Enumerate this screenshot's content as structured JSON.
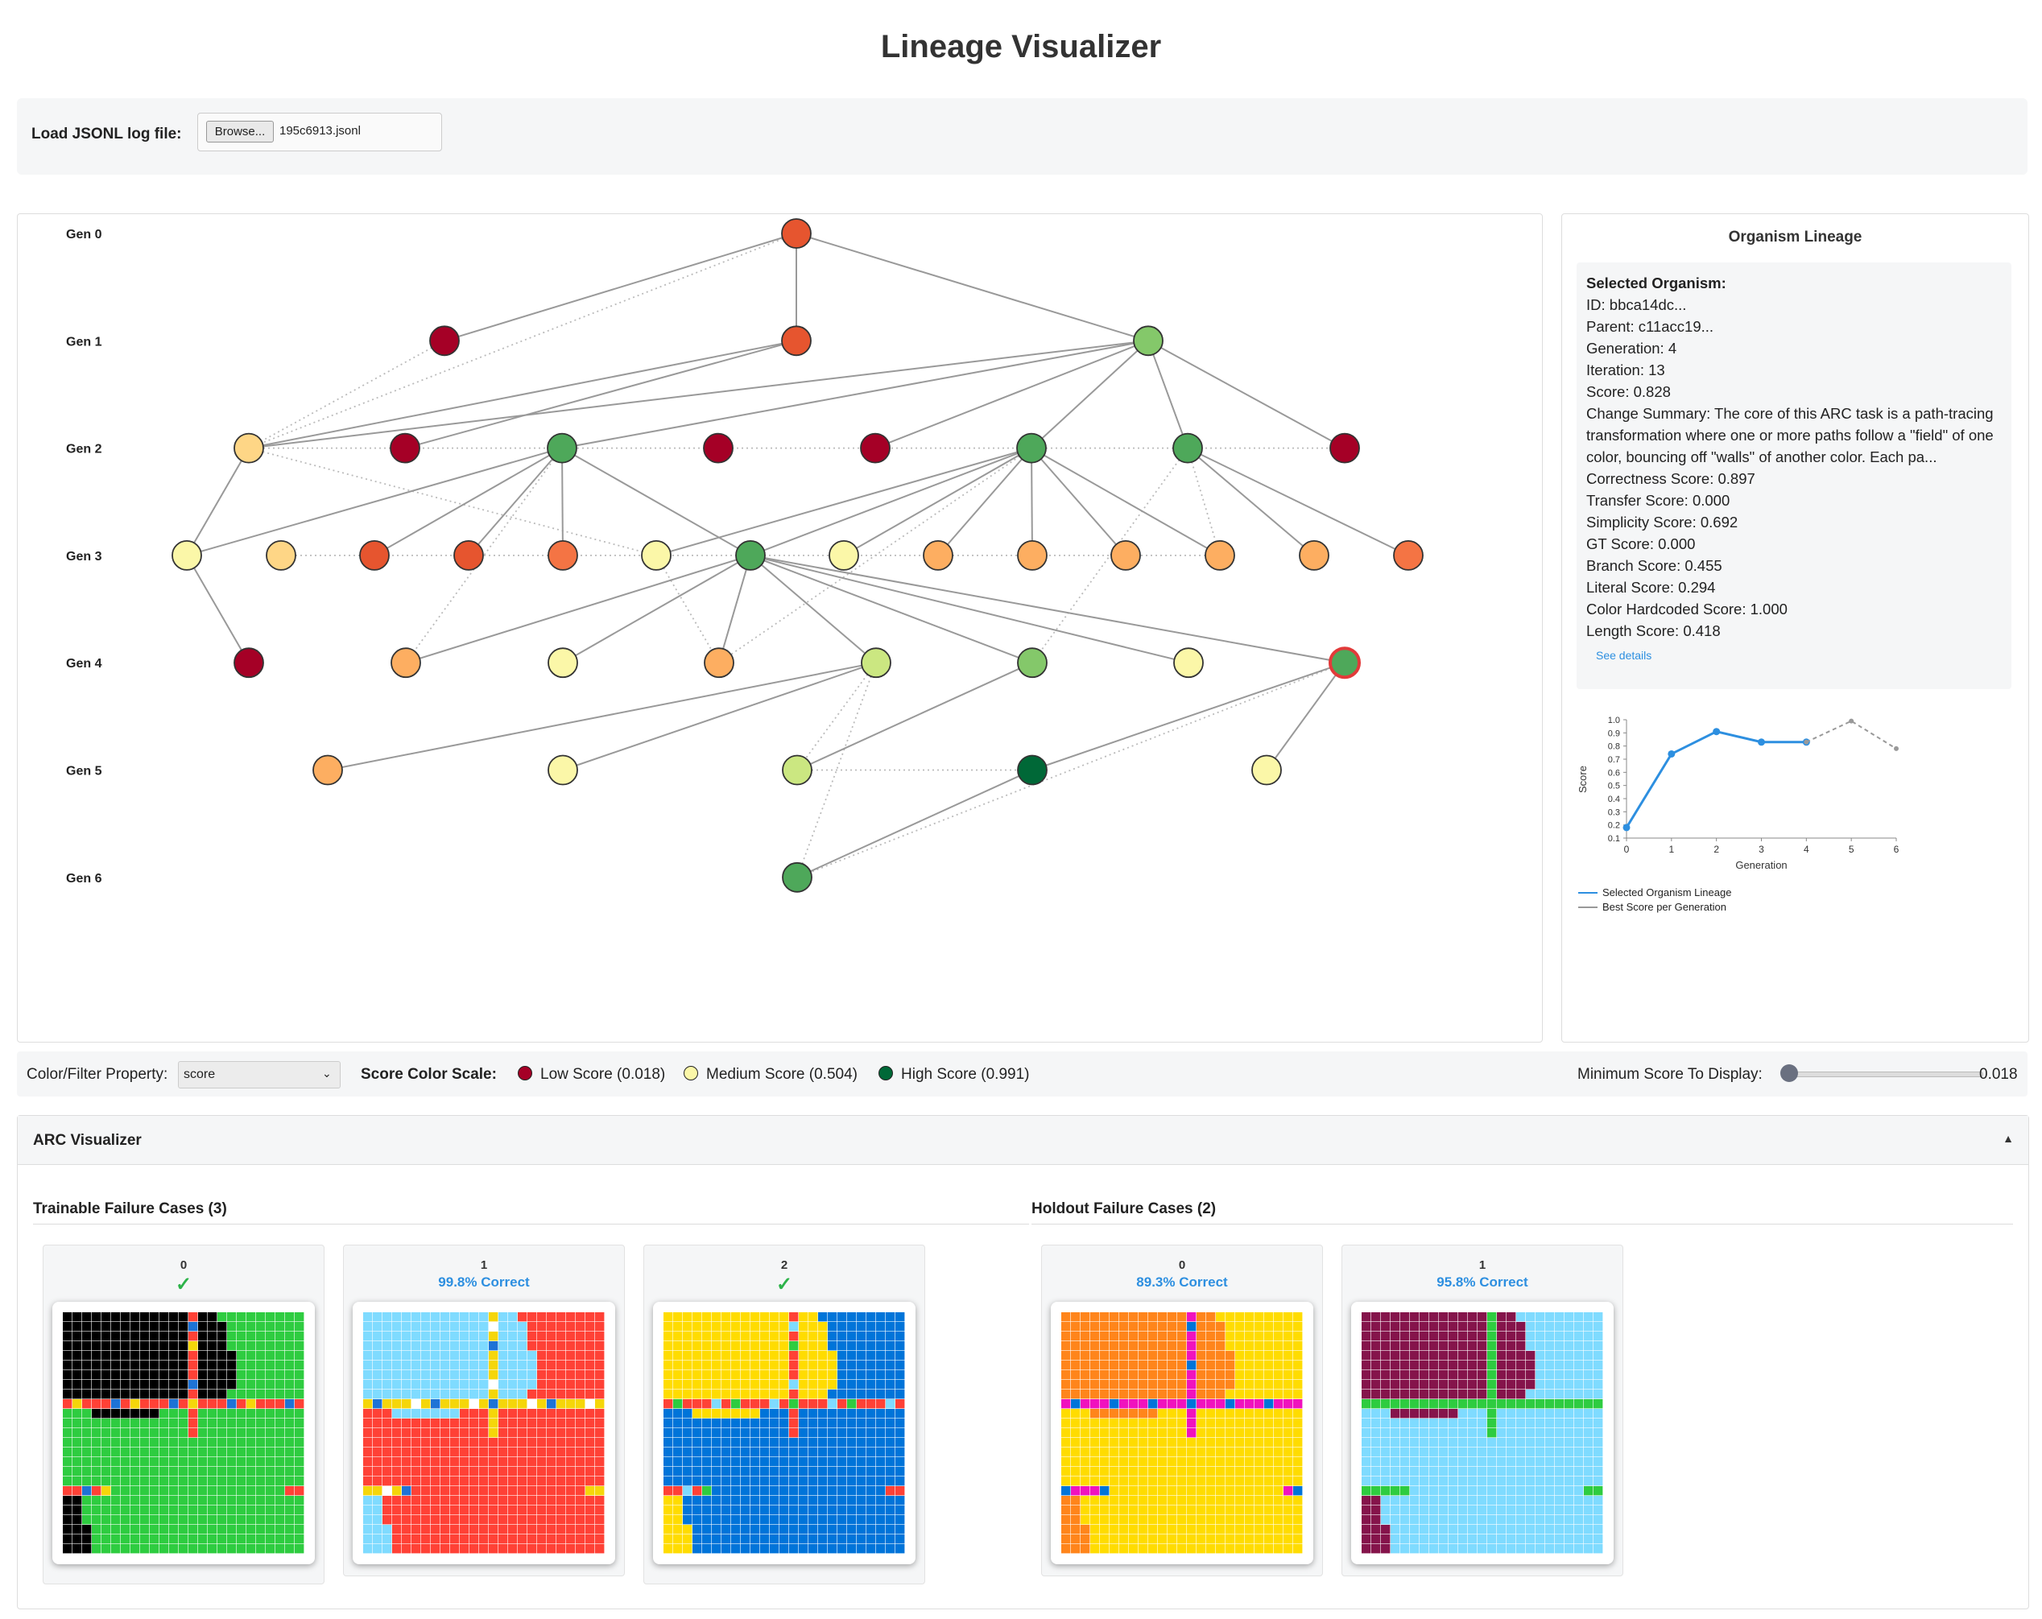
{
  "page": {
    "title": "Lineage Visualizer"
  },
  "loader": {
    "label": "Load JSONL log file:",
    "button": "Browse...",
    "filename": "195c6913.jsonl"
  },
  "graph": {
    "generations": [
      "Gen 0",
      "Gen 1",
      "Gen 2",
      "Gen 3",
      "Gen 4",
      "Gen 5",
      "Gen 6"
    ],
    "colors": {
      "dark_red": "#a50026",
      "red": "#e6552f",
      "orange": "#f47444",
      "light_orange": "#fdae61",
      "pale_orange": "#fed686",
      "pale_yellow": "#fbf7a8",
      "light_green": "#cbe781",
      "green": "#84c86a",
      "mid_green": "#4ea85a",
      "dark_green": "#006837"
    },
    "nodes": [
      {
        "id": "a",
        "gen": 0,
        "col": 967,
        "color": "red"
      },
      {
        "id": "b",
        "gen": 1,
        "col": 530,
        "color": "dark_red"
      },
      {
        "id": "c",
        "gen": 1,
        "col": 967,
        "color": "red"
      },
      {
        "id": "d",
        "gen": 1,
        "col": 1404,
        "color": "green"
      },
      {
        "id": "e",
        "gen": 2,
        "col": 287,
        "color": "pale_orange"
      },
      {
        "id": "f",
        "gen": 2,
        "col": 481,
        "color": "dark_red"
      },
      {
        "id": "g",
        "gen": 2,
        "col": 676,
        "color": "mid_green"
      },
      {
        "id": "h",
        "gen": 2,
        "col": 870,
        "color": "dark_red"
      },
      {
        "id": "i",
        "gen": 2,
        "col": 1065,
        "color": "dark_red"
      },
      {
        "id": "j",
        "gen": 2,
        "col": 1259,
        "color": "mid_green"
      },
      {
        "id": "k",
        "gen": 2,
        "col": 1453,
        "color": "mid_green"
      },
      {
        "id": "l",
        "gen": 2,
        "col": 1648,
        "color": "dark_red"
      },
      {
        "id": "m",
        "gen": 3,
        "col": 210,
        "color": "pale_yellow"
      },
      {
        "id": "n",
        "gen": 3,
        "col": 327,
        "color": "pale_orange"
      },
      {
        "id": "o",
        "gen": 3,
        "col": 443,
        "color": "red"
      },
      {
        "id": "p",
        "gen": 3,
        "col": 560,
        "color": "red"
      },
      {
        "id": "q",
        "gen": 3,
        "col": 677,
        "color": "orange"
      },
      {
        "id": "r",
        "gen": 3,
        "col": 793,
        "color": "pale_yellow"
      },
      {
        "id": "s",
        "gen": 3,
        "col": 910,
        "color": "mid_green"
      },
      {
        "id": "t",
        "gen": 3,
        "col": 1026,
        "color": "pale_yellow"
      },
      {
        "id": "u",
        "gen": 3,
        "col": 1143,
        "color": "light_orange"
      },
      {
        "id": "v",
        "gen": 3,
        "col": 1260,
        "color": "light_orange"
      },
      {
        "id": "w",
        "gen": 3,
        "col": 1376,
        "color": "light_orange"
      },
      {
        "id": "x",
        "gen": 3,
        "col": 1493,
        "color": "light_orange"
      },
      {
        "id": "y",
        "gen": 3,
        "col": 1610,
        "color": "light_orange"
      },
      {
        "id": "z",
        "gen": 3,
        "col": 1727,
        "color": "orange"
      },
      {
        "id": "A",
        "gen": 4,
        "col": 287,
        "color": "dark_red"
      },
      {
        "id": "B",
        "gen": 4,
        "col": 482,
        "color": "light_orange"
      },
      {
        "id": "C",
        "gen": 4,
        "col": 677,
        "color": "pale_yellow"
      },
      {
        "id": "D",
        "gen": 4,
        "col": 871,
        "color": "light_orange"
      },
      {
        "id": "E",
        "gen": 4,
        "col": 1066,
        "color": "light_green"
      },
      {
        "id": "F",
        "gen": 4,
        "col": 1260,
        "color": "green"
      },
      {
        "id": "G",
        "gen": 4,
        "col": 1454,
        "color": "pale_yellow"
      },
      {
        "id": "H",
        "gen": 4,
        "col": 1648,
        "color": "mid_green",
        "selected": true
      },
      {
        "id": "I",
        "gen": 5,
        "col": 385,
        "color": "light_orange"
      },
      {
        "id": "J",
        "gen": 5,
        "col": 677,
        "color": "pale_yellow"
      },
      {
        "id": "K",
        "gen": 5,
        "col": 968,
        "color": "light_green"
      },
      {
        "id": "L",
        "gen": 5,
        "col": 1260,
        "color": "dark_green"
      },
      {
        "id": "M",
        "gen": 5,
        "col": 1551,
        "color": "pale_yellow"
      },
      {
        "id": "N",
        "gen": 6,
        "col": 968,
        "color": "mid_green"
      }
    ],
    "edges": [
      [
        "a",
        "b"
      ],
      [
        "a",
        "c"
      ],
      [
        "a",
        "d"
      ],
      [
        "c",
        "e"
      ],
      [
        "c",
        "f"
      ],
      [
        "d",
        "e"
      ],
      [
        "d",
        "g"
      ],
      [
        "d",
        "j"
      ],
      [
        "d",
        "k"
      ],
      [
        "d",
        "l"
      ],
      [
        "d",
        "i"
      ],
      [
        "e",
        "m"
      ],
      [
        "g",
        "m"
      ],
      [
        "g",
        "o"
      ],
      [
        "g",
        "p"
      ],
      [
        "g",
        "q"
      ],
      [
        "g",
        "s"
      ],
      [
        "j",
        "s"
      ],
      [
        "j",
        "r"
      ],
      [
        "j",
        "u"
      ],
      [
        "j",
        "v"
      ],
      [
        "j",
        "w"
      ],
      [
        "j",
        "x"
      ],
      [
        "j",
        "t"
      ],
      [
        "k",
        "y"
      ],
      [
        "k",
        "z"
      ],
      [
        "m",
        "A"
      ],
      [
        "s",
        "B"
      ],
      [
        "s",
        "C"
      ],
      [
        "s",
        "D"
      ],
      [
        "s",
        "E"
      ],
      [
        "s",
        "F"
      ],
      [
        "s",
        "G"
      ],
      [
        "s",
        "H"
      ],
      [
        "E",
        "I"
      ],
      [
        "E",
        "J"
      ],
      [
        "F",
        "K"
      ],
      [
        "H",
        "L"
      ],
      [
        "H",
        "M"
      ],
      [
        "L",
        "N"
      ]
    ],
    "dotted_edges": [
      [
        "a",
        "e"
      ],
      [
        "b",
        "e"
      ],
      [
        "e",
        "l"
      ],
      [
        "e",
        "r"
      ],
      [
        "m",
        "e"
      ],
      [
        "g",
        "B"
      ],
      [
        "n",
        "x"
      ],
      [
        "k",
        "x"
      ],
      [
        "s",
        "D"
      ],
      [
        "r",
        "D"
      ],
      [
        "j",
        "D"
      ],
      [
        "E",
        "K"
      ],
      [
        "k",
        "F"
      ],
      [
        "K",
        "L"
      ],
      [
        "E",
        "N"
      ],
      [
        "H",
        "N"
      ]
    ]
  },
  "lineage_panel": {
    "title": "Organism Lineage",
    "heading": "Selected Organism:",
    "lines": [
      "ID: bbca14dc...",
      "Parent: c11acc19...",
      "Generation: 4",
      "Iteration: 13",
      "Score: 0.828"
    ],
    "summary": "Change Summary: The core of this ARC task is a path-tracing transformation where one or more paths follow a \"field\" of one color, bouncing off \"walls\" of another color. Each pa...",
    "scores": [
      "Correctness Score: 0.897",
      "Transfer Score: 0.000",
      "Simplicity Score: 0.692",
      "GT Score: 0.000",
      "Branch Score: 0.455",
      "Literal Score: 0.294",
      "Color Hardcoded Score: 1.000",
      "Length Score: 0.418"
    ],
    "see_details": "See details"
  },
  "chart_data": {
    "type": "line",
    "xlabel": "Generation",
    "ylabel": "Score",
    "xlim": [
      0,
      6
    ],
    "ylim": [
      0.1,
      1.0
    ],
    "x_ticks": [
      "0",
      "1",
      "2",
      "3",
      "4",
      "5",
      "6"
    ],
    "y_ticks": [
      "0.1",
      "0.2",
      "0.3",
      "0.4",
      "0.5",
      "0.6",
      "0.7",
      "0.8",
      "0.9",
      "1.0"
    ],
    "series": [
      {
        "name": "Selected Organism Lineage",
        "color": "#2d8fe0",
        "style": "solid",
        "x": [
          0,
          1,
          2,
          3,
          4
        ],
        "y": [
          0.18,
          0.74,
          0.91,
          0.83,
          0.83
        ]
      },
      {
        "name": "Best Score per Generation",
        "color": "#999999",
        "style": "dashed",
        "x": [
          4,
          5,
          6
        ],
        "y": [
          0.83,
          0.99,
          0.78
        ]
      }
    ],
    "legend": "bottom-left"
  },
  "controls": {
    "filter_label": "Color/Filter Property:",
    "filter_value": "score",
    "scale_label": "Score Color Scale:",
    "low": "Low Score (0.018)",
    "medium": "Medium Score (0.504)",
    "high": "High Score (0.991)",
    "low_color": "#a50026",
    "medium_color": "#fbf7a8",
    "high_color": "#006837",
    "min_label": "Minimum Score To Display:",
    "min_value": "0.018",
    "min_fraction": 0.0
  },
  "arc": {
    "title": "ARC Visualizer",
    "toggle": "▲",
    "trainable_title": "Trainable Failure Cases (3)",
    "holdout_title": "Holdout Failure Cases (2)",
    "trainable": [
      {
        "index": "0",
        "status": "✓",
        "kind": "ok"
      },
      {
        "index": "1",
        "status": "99.8% Correct",
        "kind": "pct"
      },
      {
        "index": "2",
        "status": "✓",
        "kind": "ok"
      }
    ],
    "holdout": [
      {
        "index": "0",
        "status": "89.3% Correct",
        "kind": "pct"
      },
      {
        "index": "1",
        "status": "95.8% Correct",
        "kind": "pct"
      }
    ]
  }
}
